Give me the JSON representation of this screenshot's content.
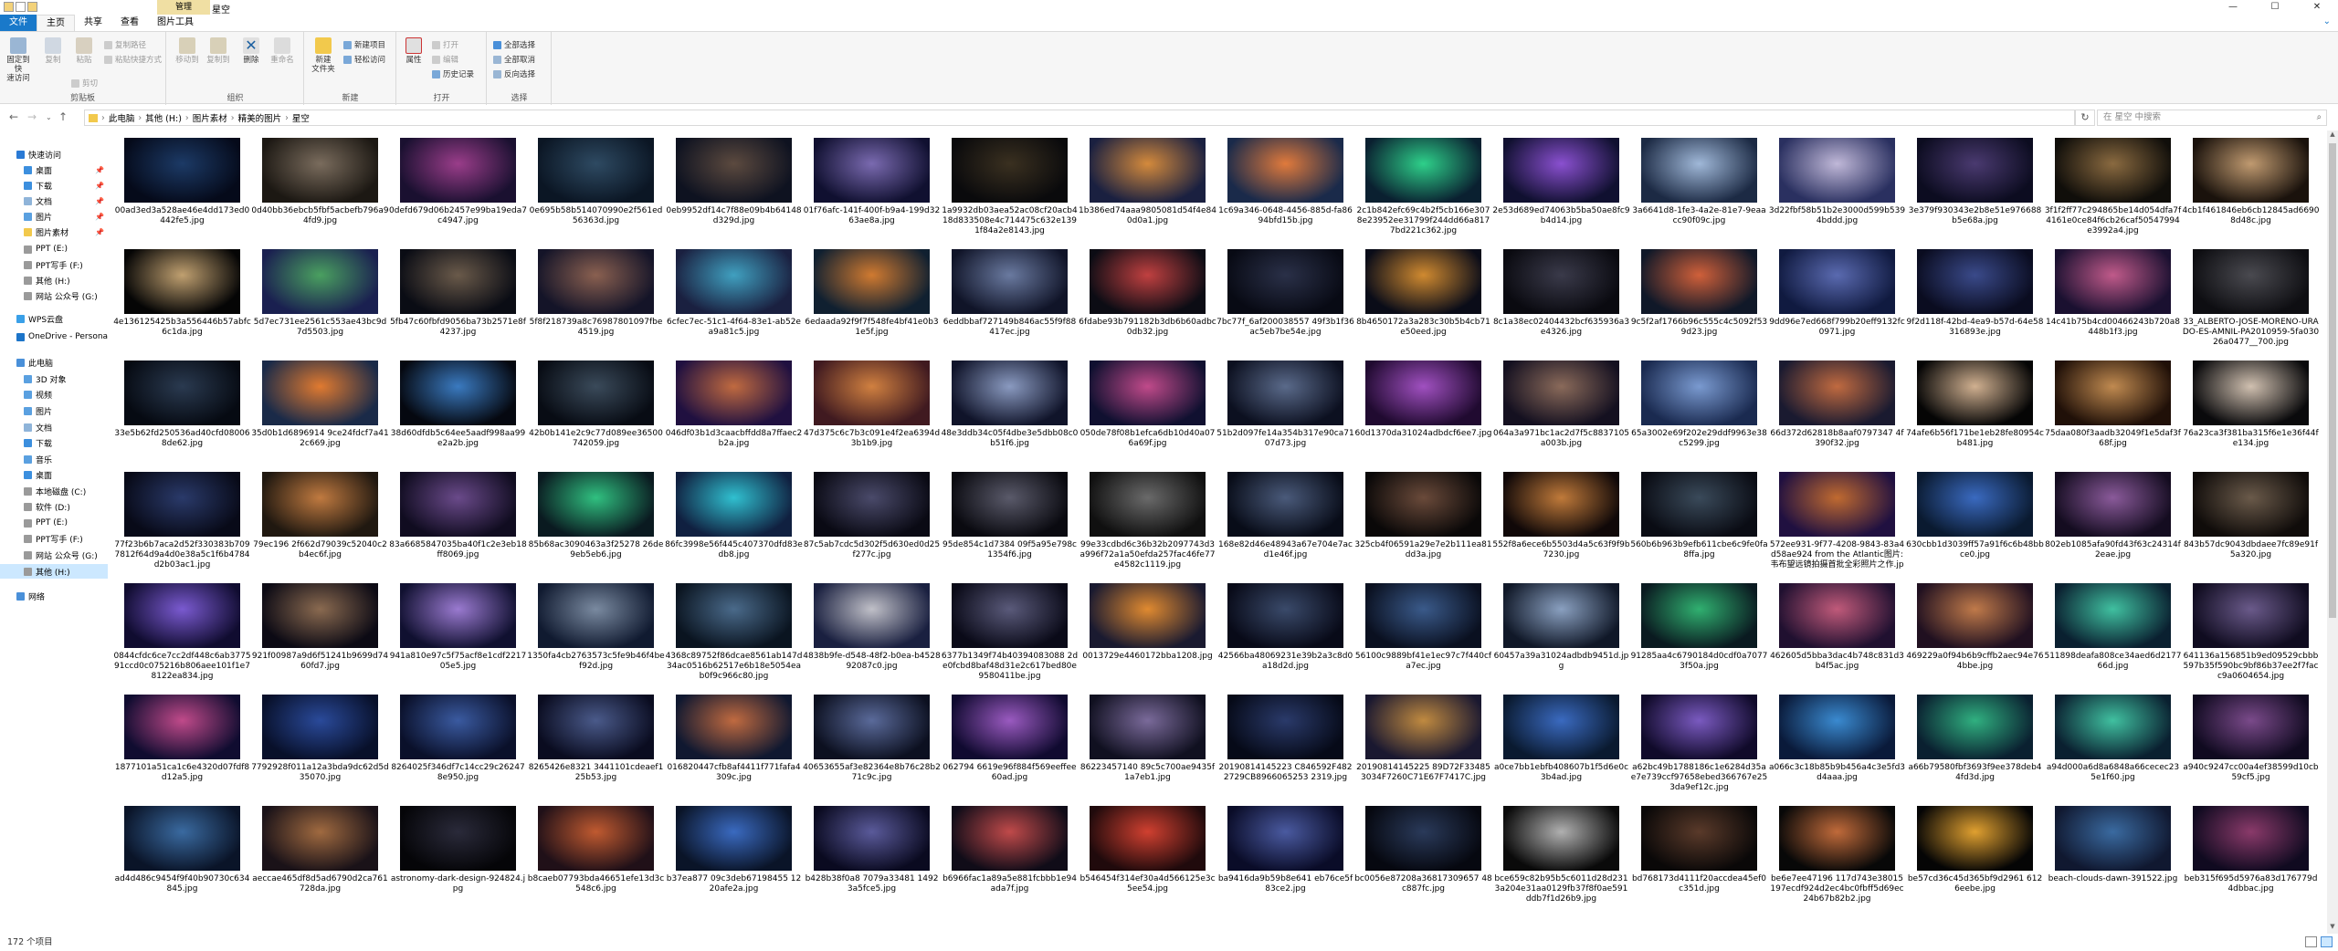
{
  "window": {
    "contextual_tab": "管理",
    "title": "星空",
    "buttons": [
      "—",
      "☐",
      "✕"
    ]
  },
  "ribbon_tabs": {
    "file": "文件",
    "items": [
      "主页",
      "共享",
      "查看",
      "图片工具"
    ],
    "help_icon": "chevron-down-icon"
  },
  "ribbon": {
    "clipboard": {
      "pin_quick": "固定到快\n速访问",
      "copy": "复制",
      "paste": "粘贴",
      "copy_path": "复制路径",
      "paste_shortcut": "粘贴快捷方式",
      "cut": "剪切",
      "label": "剪贴板"
    },
    "organize": {
      "move_to": "移动到",
      "copy_to": "复制到",
      "delete": "删除",
      "rename": "重命名",
      "label": "组织"
    },
    "new": {
      "new_folder": "新建\n文件夹",
      "new_item": "新建项目",
      "easy_access": "轻松访问",
      "label": "新建"
    },
    "open": {
      "properties": "属性",
      "open": "打开",
      "edit": "编辑",
      "history": "历史记录",
      "label": "打开"
    },
    "select": {
      "select_all": "全部选择",
      "select_none": "全部取消",
      "invert": "反向选择",
      "label": "选择"
    }
  },
  "address": {
    "crumbs": [
      "此电脑",
      "其他 (H:)",
      "图片素材",
      "精美的图片",
      "星空"
    ],
    "search_placeholder": "在 星空 中搜索"
  },
  "nav": [
    {
      "label": "快速访问",
      "level": 0,
      "pin": false,
      "color": "#2a7ad5"
    },
    {
      "label": "桌面",
      "level": 1,
      "pin": true,
      "color": "#3c8fde"
    },
    {
      "label": "下载",
      "level": 1,
      "pin": true,
      "color": "#3c8fde"
    },
    {
      "label": "文档",
      "level": 1,
      "pin": true,
      "color": "#8fb4d9"
    },
    {
      "label": "图片",
      "level": 1,
      "pin": true,
      "color": "#5aa0e0"
    },
    {
      "label": "图片素材",
      "level": 1,
      "pin": true,
      "color": "#f2c94c"
    },
    {
      "label": "PPT (E:)",
      "level": 1,
      "pin": false,
      "color": "#9a9a9a"
    },
    {
      "label": "PPT写手 (F:)",
      "level": 1,
      "pin": false,
      "color": "#9a9a9a"
    },
    {
      "label": "其他 (H:)",
      "level": 1,
      "pin": false,
      "color": "#9a9a9a"
    },
    {
      "label": "网站 公众号 (G:)",
      "level": 1,
      "pin": false,
      "color": "#9a9a9a"
    },
    {
      "label": "WPS云盘",
      "level": 0,
      "pin": false,
      "color": "#3aa0e8"
    },
    {
      "label": "OneDrive - Personal",
      "level": 0,
      "pin": false,
      "color": "#1c74c9"
    },
    {
      "label": "此电脑",
      "level": 0,
      "pin": false,
      "color": "#4a90d9"
    },
    {
      "label": "3D 对象",
      "level": 1,
      "pin": false,
      "color": "#5aa0e0"
    },
    {
      "label": "视频",
      "level": 1,
      "pin": false,
      "color": "#5aa0e0"
    },
    {
      "label": "图片",
      "level": 1,
      "pin": false,
      "color": "#5aa0e0"
    },
    {
      "label": "文档",
      "level": 1,
      "pin": false,
      "color": "#8fb4d9"
    },
    {
      "label": "下载",
      "level": 1,
      "pin": false,
      "color": "#3c8fde"
    },
    {
      "label": "音乐",
      "level": 1,
      "pin": false,
      "color": "#5aa0e0"
    },
    {
      "label": "桌面",
      "level": 1,
      "pin": false,
      "color": "#3c8fde"
    },
    {
      "label": "本地磁盘 (C:)",
      "level": 1,
      "pin": false,
      "color": "#9a9a9a"
    },
    {
      "label": "软件 (D:)",
      "level": 1,
      "pin": false,
      "color": "#9a9a9a"
    },
    {
      "label": "PPT (E:)",
      "level": 1,
      "pin": false,
      "color": "#9a9a9a"
    },
    {
      "label": "PPT写手 (F:)",
      "level": 1,
      "pin": false,
      "color": "#9a9a9a"
    },
    {
      "label": "网站 公众号 (G:)",
      "level": 1,
      "pin": false,
      "color": "#9a9a9a"
    },
    {
      "label": "其他 (H:)",
      "level": 1,
      "pin": false,
      "color": "#9a9a9a",
      "selected": true
    },
    {
      "label": "网络",
      "level": 0,
      "pin": false,
      "color": "#4a90d9"
    }
  ],
  "files": [
    {
      "name": "00ad3ed3a528ae46e4dd173ed0442fe5.jpg",
      "c1": "#1c3a66",
      "c2": "#050a1a"
    },
    {
      "name": "0d40bb36ebcb5fbf5acbefb796a94fd9.jpg",
      "c1": "#7a6c5d",
      "c2": "#1c1813"
    },
    {
      "name": "0defd679d06b2457e99ba19eda7c4947.jpg",
      "c1": "#9a3d8a",
      "c2": "#1a1030"
    },
    {
      "name": "0e695b58b514070990e2f561ed56363d.jpg",
      "c1": "#2e4a62",
      "c2": "#0b1624"
    },
    {
      "name": "0eb9952df14c7f88e09b4b64148d329d.jpg",
      "c1": "#5c4a3f",
      "c2": "#0e1220"
    },
    {
      "name": "01f76afc-141f-400f-b9a4-199d3263ae8a.jpg",
      "c1": "#7a6ab0",
      "c2": "#101030"
    },
    {
      "name": "1a9932db03aea52ac08cf20acb418d833508e4c714475c632e1391f84a2e8143.jpg",
      "c1": "#3a3020",
      "c2": "#0a0a0c"
    },
    {
      "name": "1b386ed74aaa9805081d54f4e840d0a1.jpg",
      "c1": "#d48a3c",
      "c2": "#1a2040"
    },
    {
      "name": "1c69a346-0648-4456-885d-fa8694bfd15b.jpg",
      "c1": "#e07a3c",
      "c2": "#1a2a4a"
    },
    {
      "name": "2c1b842efc69c4b2f5cb166e3078e23952ee31799f244dd66a8177bd221c362.jpg",
      "c1": "#2ed08a",
      "c2": "#0a2030"
    },
    {
      "name": "2e53d689ed74063b5ba50ae8fc9b4d14.jpg",
      "c1": "#8a50d0",
      "c2": "#101030"
    },
    {
      "name": "3a6641d8-1fe3-4a2e-81e7-9eaacc90f09c.jpg",
      "c1": "#a0b8d8",
      "c2": "#1c2a44"
    },
    {
      "name": "3d22fbf58b51b2e3000d599b5394bddd.jpg",
      "c1": "#c0b8d8",
      "c2": "#2a3060"
    },
    {
      "name": "3e379f930343e2b8e51e976688b5e68a.jpg",
      "c1": "#4a3a70",
      "c2": "#0c0c20"
    },
    {
      "name": "3f1f2ff77c294865be14d054dfa7f4161e0ce84f6cb26caf50547994e3992a4.jpg",
      "c1": "#8a6a40",
      "c2": "#100e0a"
    },
    {
      "name": "4cb1f461846eb6cb12845ad66908d48c.jpg",
      "c1": "#c09a70",
      "c2": "#1a120c"
    },
    {
      "name": "4e136125425b3a556446b57abfc6c1da.jpg",
      "c1": "#c0a070",
      "c2": "#050505"
    },
    {
      "name": "5d7ec731ee2561c553ae43bc9d7d5503.jpg",
      "c1": "#4aa060",
      "c2": "#1a2050"
    },
    {
      "name": "5fb47c60fbfd9056ba73b2571e8f4237.jpg",
      "c1": "#6a5a4a",
      "c2": "#0a0c14"
    },
    {
      "name": "5f8f218739a8c76987801097fbe4519.jpg",
      "c1": "#8a6050",
      "c2": "#141428"
    },
    {
      "name": "6cfec7ec-51c1-4f64-83e1-ab52ea9a81c5.jpg",
      "c1": "#40a0c0",
      "c2": "#1a2040"
    },
    {
      "name": "6edaada92f9f7f548fe4bf41e0b31e5f.jpg",
      "c1": "#d07a30",
      "c2": "#102030"
    },
    {
      "name": "6eddbbaf727149b846ac55f9f88417ec.jpg",
      "c1": "#6a7aa0",
      "c2": "#101428"
    },
    {
      "name": "6fdabe93b791182b3db6b60adbc0db32.jpg",
      "c1": "#c04040",
      "c2": "#0c0c14"
    },
    {
      "name": "7bc77f_6af200038557 49f3b1f36ac5eb7be54e.jpg",
      "c1": "#2a3048",
      "c2": "#080a14"
    },
    {
      "name": "8b4650172a3a283c30b5b4cb71e50eed.jpg",
      "c1": "#d08a30",
      "c2": "#0a0c18"
    },
    {
      "name": "8c1a38ec02404432bcf635936a3e4326.jpg",
      "c1": "#3a3a4a",
      "c2": "#0a0a10"
    },
    {
      "name": "9c5f2af1766b96c555c4c5092f539d23.jpg",
      "c1": "#d0603a",
      "c2": "#101828"
    },
    {
      "name": "9dd96e7ed668f799b20eff9132fc0971.jpg",
      "c1": "#5a6ab0",
      "c2": "#101a40"
    },
    {
      "name": "9f2d118f-42bd-4ea9-b57d-64e58316893e.jpg",
      "c1": "#3a4a8a",
      "c2": "#0a0c20"
    },
    {
      "name": "14c41b75b4cd00466243b720a8448b1f3.jpg",
      "c1": "#c05a8a",
      "c2": "#1a1030"
    },
    {
      "name": "33_ALBERTO-JOSE-MORENO-URADO-ES-AMNIL-PA2010959-5fa03026a0477__700.jpg",
      "c1": "#4a4a50",
      "c2": "#0e0e12"
    },
    {
      "name": "33e5b62fd250536ad40cfd080068de62.jpg",
      "c1": "#2a3a50",
      "c2": "#060a12"
    },
    {
      "name": "35d0b1d6896914 9ce24fdcf7a412c669.jpg",
      "c1": "#e07a30",
      "c2": "#1a2a48"
    },
    {
      "name": "38d60dfdb5c64ee5aadf998aa99e2a2b.jpg",
      "c1": "#3a7ac0",
      "c2": "#050810"
    },
    {
      "name": "42b0b141e2c9c77d089ee36500742059.jpg",
      "c1": "#3a4a5a",
      "c2": "#080c14"
    },
    {
      "name": "046df03b1d3caacbffdd8a7ffaec2b2a.jpg",
      "c1": "#c06a40",
      "c2": "#201040"
    },
    {
      "name": "47d375c6c7b3c091e4f2ea6394d3b1b9.jpg",
      "c1": "#d08040",
      "c2": "#401a20"
    },
    {
      "name": "48e3ddb34c05f4dbe3e5dbb08c0b51f6.jpg",
      "c1": "#8a9ac0",
      "c2": "#10142a"
    },
    {
      "name": "050de78f08b1efca6db10d40a076a69f.jpg",
      "c1": "#c04a8a",
      "c2": "#101030"
    },
    {
      "name": "51b2d097fe14a354b317e90ca7107d73.jpg",
      "c1": "#5a6a8a",
      "c2": "#0c1020"
    },
    {
      "name": "60d1370da31024adbdcf6ee7.jpg",
      "c1": "#a050c0",
      "c2": "#200a30"
    },
    {
      "name": "064a3a971bc1ac2d7f5c8837105a003b.jpg",
      "c1": "#8a6a5a",
      "c2": "#141020"
    },
    {
      "name": "65a3002e69f202e29ddf9963e38c5299.jpg",
      "c1": "#7a9ad0",
      "c2": "#1a2a50"
    },
    {
      "name": "66d372d62818b8aaf0797347 4f390f32.jpg",
      "c1": "#c06a40",
      "c2": "#1a1a30"
    },
    {
      "name": "74afe6b56f171be1eb28fe80954cb481.jpg",
      "c1": "#d0b090",
      "c2": "#050505"
    },
    {
      "name": "75daa080f3aadb32049f1e5daf3f68f.jpg",
      "c1": "#c08a50",
      "c2": "#201008"
    },
    {
      "name": "76a23ca3f381ba315f6e1e36f44fe134.jpg",
      "c1": "#d0c0b0",
      "c2": "#0a0a0c"
    },
    {
      "name": "77f23b6b7aca2d52f330383b7097812f64d9a4d0e38a5c1f6b4784d2b03ac1.jpg",
      "c1": "#2a3a6a",
      "c2": "#080a18"
    },
    {
      "name": "79ec196 2f662d79039c52040c2b4ec6f.jpg",
      "c1": "#c07a40",
      "c2": "#201810"
    },
    {
      "name": "83a6685847035ba40f1c2e3eb18ff8069.jpg",
      "c1": "#6a4a8a",
      "c2": "#100c20"
    },
    {
      "name": "85b68ac3090463a3f25278 26de9eb5eb6.jpg",
      "c1": "#30c080",
      "c2": "#0a1a20"
    },
    {
      "name": "86fc3998e56f445c407370dfd83edb8.jpg",
      "c1": "#30c0d0",
      "c2": "#102040"
    },
    {
      "name": "87c5ab7cdc5d302f5d630ed0d25f277c.jpg",
      "c1": "#4a4a6a",
      "c2": "#0a0a14"
    },
    {
      "name": "95de854c1d7384 09f5a95e798c1354f6.jpg",
      "c1": "#5a5a6a",
      "c2": "#0a0a10"
    },
    {
      "name": "99e33cdbd6c36b32b2097743d3a996f72a1a50efda257fac46fe77e4582c1119.jpg",
      "c1": "#6a6a6a",
      "c2": "#101010"
    },
    {
      "name": "168e82d46e48943a67e704e7acd1e46f.jpg",
      "c1": "#4a5a7a",
      "c2": "#080c18"
    },
    {
      "name": "325cb4f06591a29e7e2b111ea81dd3a.jpg",
      "c1": "#6a4a3a",
      "c2": "#0a0808"
    },
    {
      "name": "552f8a6ece6b5503d4a5c63f9f9b7230.jpg",
      "c1": "#c07a3a",
      "c2": "#100808"
    },
    {
      "name": "560b6b963b9efb611cbe6c9fe0fa8ffa.jpg",
      "c1": "#3a4a5a",
      "c2": "#0a0c14"
    },
    {
      "name": "572ee931-9f77-4208-9843-83a4d58ae924 from the Atlantic图片: 韦布望远镜拍摄首批全彩照片之作.jpg",
      "c1": "#c06a30",
      "c2": "#201040"
    },
    {
      "name": "630cbb1d3039ff57a91f6c6b48bbce0.jpg",
      "c1": "#3a6ac0",
      "c2": "#0a1a30"
    },
    {
      "name": "802eb1085afa90fd43f63c24314f2eae.jpg",
      "c1": "#8a5a9a",
      "c2": "#140c20"
    },
    {
      "name": "843b57dc9043dbdaee7fc89e91f5a320.jpg",
      "c1": "#6a5a4a",
      "c2": "#100c0a"
    },
    {
      "name": "0844cfdc6ce7cc2df448c6ab377591ccd0c075216b806aee101f1e78122ea834.jpg",
      "c1": "#7a5ad0",
      "c2": "#100c30"
    },
    {
      "name": "921f00987a9d6f51241b9699d7460fd7.jpg",
      "c1": "#8a6a50",
      "c2": "#0c0a14"
    },
    {
      "name": "941a810e97c5f75acf8e1cdf221705e5.jpg",
      "c1": "#9a7ad0",
      "c2": "#101030"
    },
    {
      "name": "1350fa4cb2763573c5fe9b46f4bef92d.jpg",
      "c1": "#7a8aa0",
      "c2": "#101a30"
    },
    {
      "name": "4368c89752f86dcae8561ab147d34ac0516b62517e6b18e5054eab0f9c966c80.jpg",
      "c1": "#4a6a8a",
      "c2": "#0a1420"
    },
    {
      "name": "4838b9fe-d548-48f2-b0ea-b452892087c0.jpg",
      "c1": "#c0c0c8",
      "c2": "#1a2040"
    },
    {
      "name": "6377b1349f74b40394083088 2de0fcbd8baf48d31e2c617bed80e9580411be.jpg",
      "c1": "#5a5a7a",
      "c2": "#0a0a18"
    },
    {
      "name": "0013729e4460172bba1208.jpg",
      "c1": "#e08a30",
      "c2": "#1a1a30"
    },
    {
      "name": "42566ba48069231e39b2a3c8d0a18d2d.jpg",
      "c1": "#3a4a6a",
      "c2": "#080a18"
    },
    {
      "name": "56100c9889bf41e1ec97c7f440cfa7ec.jpg",
      "c1": "#3a5a8a",
      "c2": "#0a1020"
    },
    {
      "name": "60457a39a31024adbdb9451d.jpg",
      "c1": "#8aa0c0",
      "c2": "#101828"
    },
    {
      "name": "91285aa4c6790184d0cdf0a70773f50a.jpg",
      "c1": "#30b070",
      "c2": "#0a1a20"
    },
    {
      "name": "462605d5bba3dac4b748c831d3b4f5ac.jpg",
      "c1": "#c05a7a",
      "c2": "#201030"
    },
    {
      "name": "469229a0f94b6b9cffb2aec94e764bbe.jpg",
      "c1": "#c07a4a",
      "c2": "#201020"
    },
    {
      "name": "511898deafa808ce34aed6d217766d.jpg",
      "c1": "#40c0a0",
      "c2": "#0a2030"
    },
    {
      "name": "641136a156851b9ed09529cbbb597b35f590bc9bf86b37ee2f7facc9a0604654.jpg",
      "c1": "#6a5a8a",
      "c2": "#100c20"
    },
    {
      "name": "1877101a51ca1c6e4320d07fdf8d12a5.jpg",
      "c1": "#c04a8a",
      "c2": "#100c30"
    },
    {
      "name": "7792928f011a12a3bda9dc62d5d35070.jpg",
      "c1": "#2a4a9a",
      "c2": "#08102a"
    },
    {
      "name": "8264025f346df7c14cc29c262478e950.jpg",
      "c1": "#3a5aa0",
      "c2": "#0a102a"
    },
    {
      "name": "8265426e8321 3441101cdeaef125b53.jpg",
      "c1": "#4a5a8a",
      "c2": "#0a0c20"
    },
    {
      "name": "016820447cfb8af4411f771fafa4309c.jpg",
      "c1": "#c06a40",
      "c2": "#101830"
    },
    {
      "name": "40653655af3e82364e8b76c28b271c9c.jpg",
      "c1": "#5a6a9a",
      "c2": "#0c1020"
    },
    {
      "name": "062794 6619e96f884f569eeffee60ad.jpg",
      "c1": "#9a5ac0",
      "c2": "#100a30"
    },
    {
      "name": "86223457140 89c5c700ae9435f1a7eb1.jpg",
      "c1": "#7a6a9a",
      "c2": "#101020"
    },
    {
      "name": "20190814145223 C846592F4822729CB8966065253 2319.jpg",
      "c1": "#2a3a6a",
      "c2": "#060a18"
    },
    {
      "name": "20190814145225 89D72F33485 3034F7260C71E67F7417C.jpg",
      "c1": "#c08a40",
      "c2": "#1a1830"
    },
    {
      "name": "a0ce7bb1ebfb408607b1f5d6e0c3b4ad.jpg",
      "c1": "#3a6ac0",
      "c2": "#0a1a30"
    },
    {
      "name": "a62bc49b1788186c1e6284d35ae7e739ccf97658ebed366767e253da9ef12c.jpg",
      "c1": "#7a5ac0",
      "c2": "#100a2a"
    },
    {
      "name": "a066c3c18b85b9b456a4c3e5fd3d4aaa.jpg",
      "c1": "#3a8ad0",
      "c2": "#0a1a3a"
    },
    {
      "name": "a66b79580fbf3693f9ee378deb44fd3d.jpg",
      "c1": "#30b080",
      "c2": "#0a2030"
    },
    {
      "name": "a94d000a6d8a6848a66cecec235e1f60.jpg",
      "c1": "#40c0a0",
      "c2": "#0a2030"
    },
    {
      "name": "a940c9247cc00a4ef38599d10cb59cf5.jpg",
      "c1": "#7a4a8a",
      "c2": "#100a20"
    },
    {
      "name": "ad4d486c9454f9f40b90730c634845.jpg",
      "c1": "#3a6aa0",
      "c2": "#0a1428"
    },
    {
      "name": "aeccae465df8d5ad6790d2ca761728da.jpg",
      "c1": "#a06a40",
      "c2": "#1a1218"
    },
    {
      "name": "astronomy-dark-design-924824.jpg",
      "c1": "#2a2a3a",
      "c2": "#050508"
    },
    {
      "name": "b8caeb07793bda46651efe13d3c548c6.jpg",
      "c1": "#c05a30",
      "c2": "#201018"
    },
    {
      "name": "b37ea877 09c3deb67198455 1220afe2a.jpg",
      "c1": "#3a6ac0",
      "c2": "#0a1428"
    },
    {
      "name": "b428b38f0a8 7079a33481 14923a5fce5.jpg",
      "c1": "#5a5a9a",
      "c2": "#0a0a20"
    },
    {
      "name": "b6966fac1a89a5e881fcbbb1e94ada7f.jpg",
      "c1": "#c04a4a",
      "c2": "#100c18"
    },
    {
      "name": "b546454f314ef30a4d566125e3c5ee54.jpg",
      "c1": "#d04030",
      "c2": "#200a0c"
    },
    {
      "name": "ba9416da9b59b8e641 eb76ce5f83ce2.jpg",
      "c1": "#4a5aa0",
      "c2": "#0a0c28"
    },
    {
      "name": "bc0056e87208a36817309657 48c887fc.jpg",
      "c1": "#2a3a5a",
      "c2": "#060810"
    },
    {
      "name": "bce659c82b95b5c6011d28d2313a204e31aa0129fb37f8f0ae591ddb7f1d26b9.jpg",
      "c1": "#b0b0b0",
      "c2": "#0a0a0a"
    },
    {
      "name": "bd768173d4111f20accdea45ef0c351d.jpg",
      "c1": "#5a3a2a",
      "c2": "#0a0808"
    },
    {
      "name": "be6e7ee47196 117d743e38015 197ecdf924d2ec4bc0fbff5d69ec24b67b82b2.jpg",
      "c1": "#c06a3a",
      "c2": "#080808"
    },
    {
      "name": "be57cd36c45d365bf9d2961 6126eebe.jpg",
      "c1": "#e0a030",
      "c2": "#050505"
    },
    {
      "name": "beach-clouds-dawn-391522.jpg",
      "c1": "#3a6aa0",
      "c2": "#101830"
    },
    {
      "name": "beb315f695d5976a83d176779d4dbbac.jpg",
      "c1": "#8a3a6a",
      "c2": "#100a20"
    }
  ],
  "status": {
    "count": "172 个项目"
  }
}
